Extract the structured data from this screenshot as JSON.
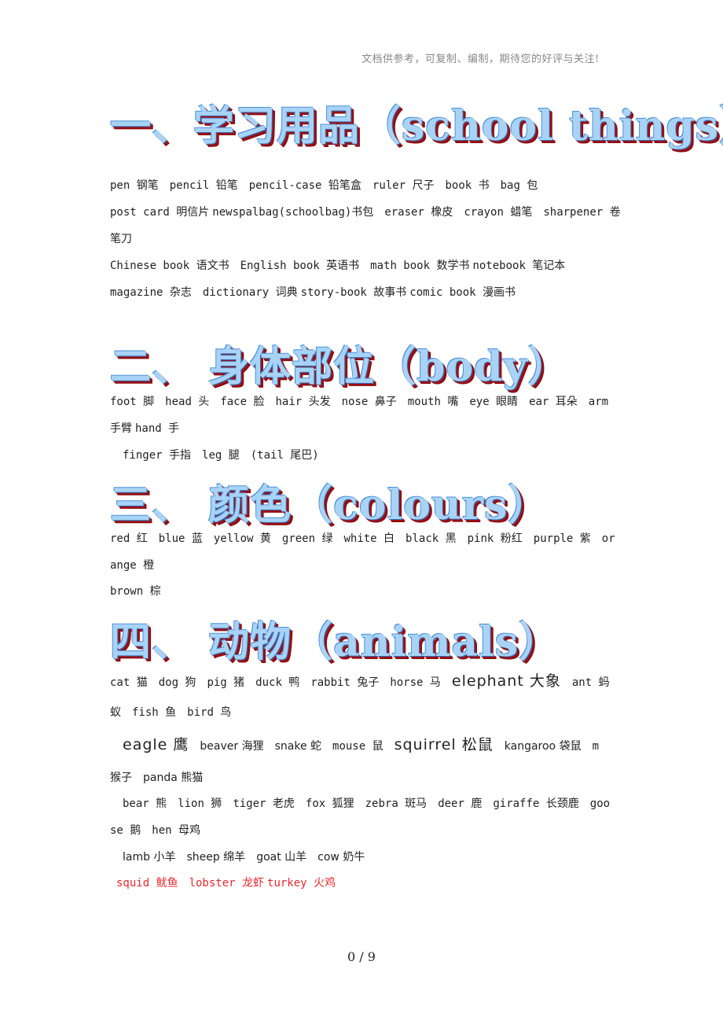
{
  "header_note": "文档供参考，可复制、编制，期待您的好评与关注!",
  "sections": [
    {
      "heading": "一、学习用品（school things）",
      "lines": [
        [
          "pen 钢笔",
          "pencil 铅笔",
          "pencil-case 铅笔盒",
          "ruler 尺子",
          "book 书",
          "bag 包"
        ],
        [
          "post card 明信片",
          "newspalbag(schoolbag)书包",
          "eraser 橡皮",
          "crayon 蜡笔",
          "sharpener 卷"
        ],
        [
          "笔刀"
        ],
        [
          "Chinese book 语文书",
          "English book 英语书",
          "math book 数学书",
          "notebook 笔记本"
        ],
        [
          "magazine 杂志",
          "dictionary 词典",
          "story-book 故事书",
          "comic book 漫画书"
        ]
      ]
    },
    {
      "heading": "二、 身体部位（body）",
      "lines": [
        [
          "foot 脚",
          "head 头",
          "face 脸",
          "hair 头发",
          "nose 鼻子",
          "mouth 嘴",
          "eye 眼睛",
          "ear 耳朵",
          "arm"
        ],
        [
          "手臂",
          "hand 手"
        ],
        [
          "finger 手指",
          "leg 腿",
          "(tail 尾巴)"
        ]
      ]
    },
    {
      "heading": "三、 颜色（colours）",
      "lines": [
        [
          "red 红",
          "blue 蓝",
          "yellow 黄",
          "green 绿",
          "white 白",
          "black 黑",
          "pink 粉红",
          "purple 紫",
          "or"
        ],
        [
          "ange 橙"
        ],
        [
          "brown 棕"
        ]
      ]
    },
    {
      "heading": "四、 动物（animals）",
      "lines": [
        [
          "cat 猫",
          "dog 狗",
          "pig 猪",
          "duck 鸭",
          "rabbit 兔子",
          "horse 马",
          "elephant 大象",
          "ant 蚂"
        ],
        [
          "蚁",
          "fish 鱼",
          "bird 鸟"
        ],
        [
          "eagle 鹰",
          "beaver 海狸",
          "snake 蛇",
          "mouse 鼠",
          "squirrel 松鼠",
          "kangaroo 袋鼠",
          "m"
        ],
        [
          "猴子",
          "panda 熊猫"
        ],
        [
          "bear 熊",
          "lion 狮",
          "tiger 老虎",
          "fox 狐狸",
          "zebra 斑马",
          "deer 鹿",
          "giraffe 长颈鹿",
          "goo"
        ],
        [
          "se 鹅",
          "hen 母鸡"
        ],
        [
          "lamb 小羊",
          "sheep 绵羊",
          "goat 山羊",
          "cow 奶牛"
        ],
        [
          "squid 鱿鱼",
          "lobster 龙虾",
          "turkey 火鸡"
        ]
      ]
    }
  ],
  "highlight_color": "#e8282c",
  "page_number": "0 / 9"
}
